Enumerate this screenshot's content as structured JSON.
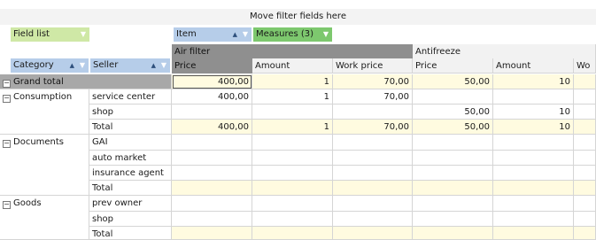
{
  "filter_bar": {
    "hint": "Move filter fields here"
  },
  "chips": {
    "field_list": "Field list",
    "item": "Item",
    "measures": "Measures (3)",
    "category": "Category",
    "seller": "Seller"
  },
  "columns": {
    "groups": [
      "Air filter",
      "Antifreeze"
    ],
    "measures": [
      "Price",
      "Amount",
      "Work price",
      "Price",
      "Amount",
      "Wo"
    ]
  },
  "rows": [
    {
      "category": "Grand total",
      "seller": "",
      "values": [
        "400,00",
        "1",
        "70,00",
        "50,00",
        "10",
        ""
      ]
    },
    {
      "category": "Consumption",
      "seller": "service center",
      "values": [
        "400,00",
        "1",
        "70,00",
        "",
        "",
        ""
      ]
    },
    {
      "category": "",
      "seller": "shop",
      "values": [
        "",
        "",
        "",
        "50,00",
        "10",
        ""
      ]
    },
    {
      "category": "",
      "seller": "Total",
      "values": [
        "400,00",
        "1",
        "70,00",
        "50,00",
        "10",
        ""
      ]
    },
    {
      "category": "Documents",
      "seller": "GAI",
      "values": [
        "",
        "",
        "",
        "",
        "",
        ""
      ]
    },
    {
      "category": "",
      "seller": "auto market",
      "values": [
        "",
        "",
        "",
        "",
        "",
        ""
      ]
    },
    {
      "category": "",
      "seller": "insurance agent",
      "values": [
        "",
        "",
        "",
        "",
        "",
        ""
      ]
    },
    {
      "category": "",
      "seller": "Total",
      "values": [
        "",
        "",
        "",
        "",
        "",
        ""
      ]
    },
    {
      "category": "Goods",
      "seller": "prev owner",
      "values": [
        "",
        "",
        "",
        "",
        "",
        ""
      ]
    },
    {
      "category": "",
      "seller": "shop",
      "values": [
        "",
        "",
        "",
        "",
        "",
        ""
      ]
    },
    {
      "category": "",
      "seller": "Total",
      "values": [
        "",
        "",
        "",
        "",
        "",
        ""
      ]
    }
  ],
  "icons": {
    "dropdown": "chevron-down-icon",
    "sort": "sort-ascending-icon",
    "collapse": "minus-box-icon"
  }
}
